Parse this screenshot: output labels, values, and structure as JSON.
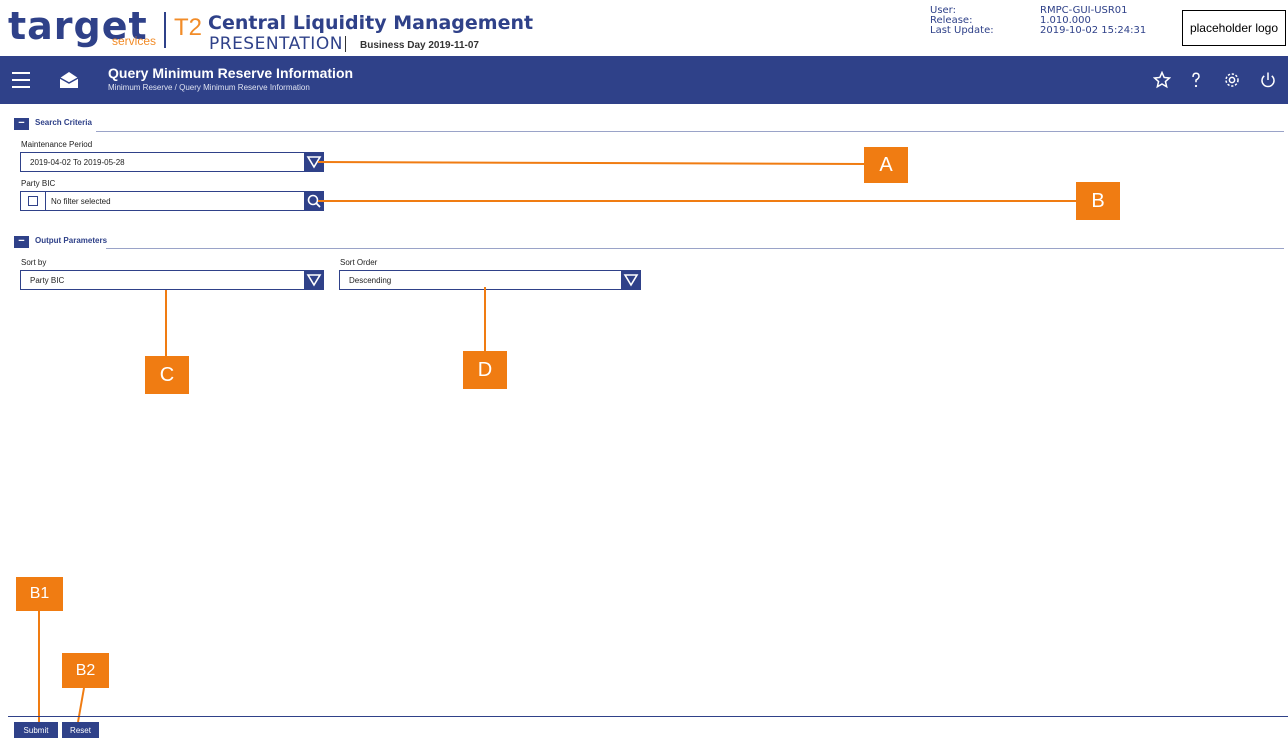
{
  "header": {
    "brand": "target",
    "brand_sub": "services",
    "service": "T2",
    "app_title": "Central Liquidity Management",
    "environment": "PRESENTATION",
    "business_day": "Business Day 2019-11-07",
    "user_label": "User:",
    "release_label": "Release:",
    "last_update_label": "Last Update:",
    "user_value": "RMPC-GUI-USR01",
    "release_value": "1.010.000",
    "last_update_value": "2019-10-02 15:24:31",
    "placeholder_logo": "placeholder logo"
  },
  "nav": {
    "title": "Query Minimum Reserve Information",
    "breadcrumb": "Minimum Reserve  /  Query Minimum Reserve Information",
    "icons": [
      "menu-icon",
      "mail-icon",
      "star-icon",
      "help-icon",
      "settings-icon",
      "power-icon"
    ]
  },
  "search_criteria": {
    "title": "Search Criteria",
    "collapse": "−",
    "maintenance_period_label": "Maintenance Period",
    "maintenance_period_value": "2019-04-02 To 2019-05-28",
    "party_bic_label": "Party BIC",
    "party_bic_value": "No filter selected"
  },
  "output_parameters": {
    "title": "Output Parameters",
    "collapse": "−",
    "sort_by_label": "Sort by",
    "sort_by_value": "Party BIC",
    "sort_order_label": "Sort Order",
    "sort_order_value": "Descending"
  },
  "callouts": {
    "a": "A",
    "b": "B",
    "c": "C",
    "d": "D",
    "b1": "B1",
    "b2": "B2"
  },
  "footer": {
    "submit": "Submit",
    "reset": "Reset"
  },
  "colors": {
    "primary": "#2f4189",
    "accent": "#f07c12"
  }
}
